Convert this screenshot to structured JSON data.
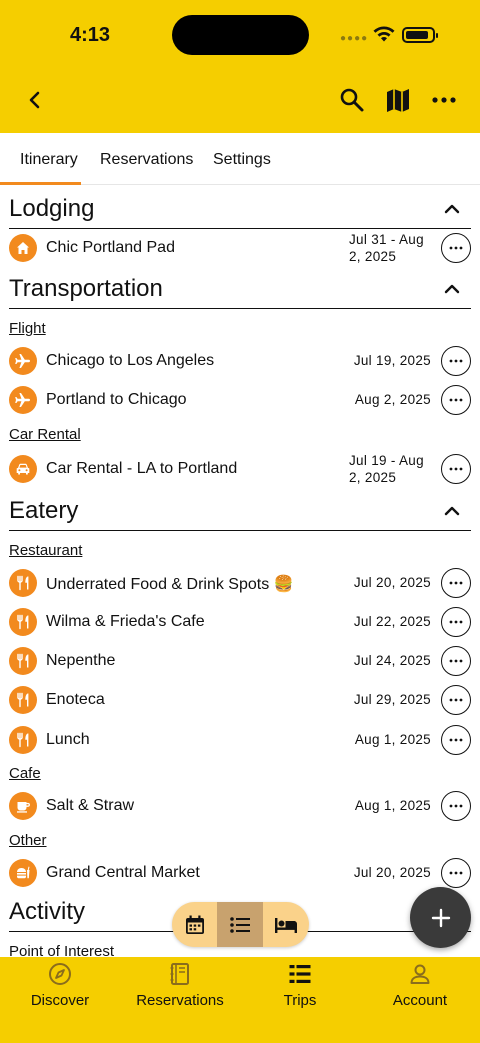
{
  "status": {
    "time": "4:13"
  },
  "tabs": [
    {
      "label": "Itinerary",
      "active": true
    },
    {
      "label": "Reservations",
      "active": false
    },
    {
      "label": "Settings",
      "active": false
    }
  ],
  "sections": {
    "lodging": {
      "title": "Lodging",
      "items": [
        {
          "icon": "home-icon",
          "name": "Chic Portland Pad",
          "date_line1": "Jul 31 - Aug",
          "date_line2": "2, 2025"
        }
      ]
    },
    "transportation": {
      "title": "Transportation",
      "flight_label": "Flight",
      "flights": [
        {
          "icon": "airplane-icon",
          "name": "Chicago to Los Angeles",
          "date": "Jul 19, 2025"
        },
        {
          "icon": "airplane-icon",
          "name": "Portland to Chicago",
          "date": "Aug 2, 2025"
        }
      ],
      "car_label": "Car Rental",
      "cars": [
        {
          "icon": "car-icon",
          "name": "Car Rental - LA to Portland",
          "date_line1": "Jul 19 - Aug",
          "date_line2": "2, 2025"
        }
      ]
    },
    "eatery": {
      "title": "Eatery",
      "restaurant_label": "Restaurant",
      "restaurants": [
        {
          "icon": "fork-knife-icon",
          "name": "Underrated Food & Drink Spots 🍔",
          "date": "Jul 20, 2025"
        },
        {
          "icon": "fork-knife-icon",
          "name": "Wilma & Frieda's Cafe",
          "date": "Jul 22, 2025"
        },
        {
          "icon": "fork-knife-icon",
          "name": "Nepenthe",
          "date": "Jul 24, 2025"
        },
        {
          "icon": "fork-knife-icon",
          "name": "Enoteca",
          "date": "Jul 29, 2025"
        },
        {
          "icon": "fork-knife-icon",
          "name": "Lunch",
          "date": "Aug 1, 2025"
        }
      ],
      "cafe_label": "Cafe",
      "cafes": [
        {
          "icon": "coffee-cup-icon",
          "name": "Salt & Straw",
          "date": "Aug 1, 2025"
        }
      ],
      "other_label": "Other",
      "others": [
        {
          "icon": "fast-food-icon",
          "name": "Grand Central Market",
          "date": "Jul 20, 2025"
        }
      ]
    },
    "activity": {
      "title": "Activity",
      "poi_label": "Point of Interest"
    }
  },
  "view_switcher": [
    "calendar-icon",
    "list-icon",
    "bed-icon"
  ],
  "bottom_nav": [
    {
      "label": "Discover",
      "icon": "compass-icon"
    },
    {
      "label": "Reservations",
      "icon": "notebook-icon"
    },
    {
      "label": "Trips",
      "icon": "itinerary-list-icon"
    },
    {
      "label": "Account",
      "icon": "person-icon"
    }
  ],
  "colors": {
    "header": "#F5CE00",
    "accent": "#F28A1E",
    "fab": "#3a3a3a"
  }
}
